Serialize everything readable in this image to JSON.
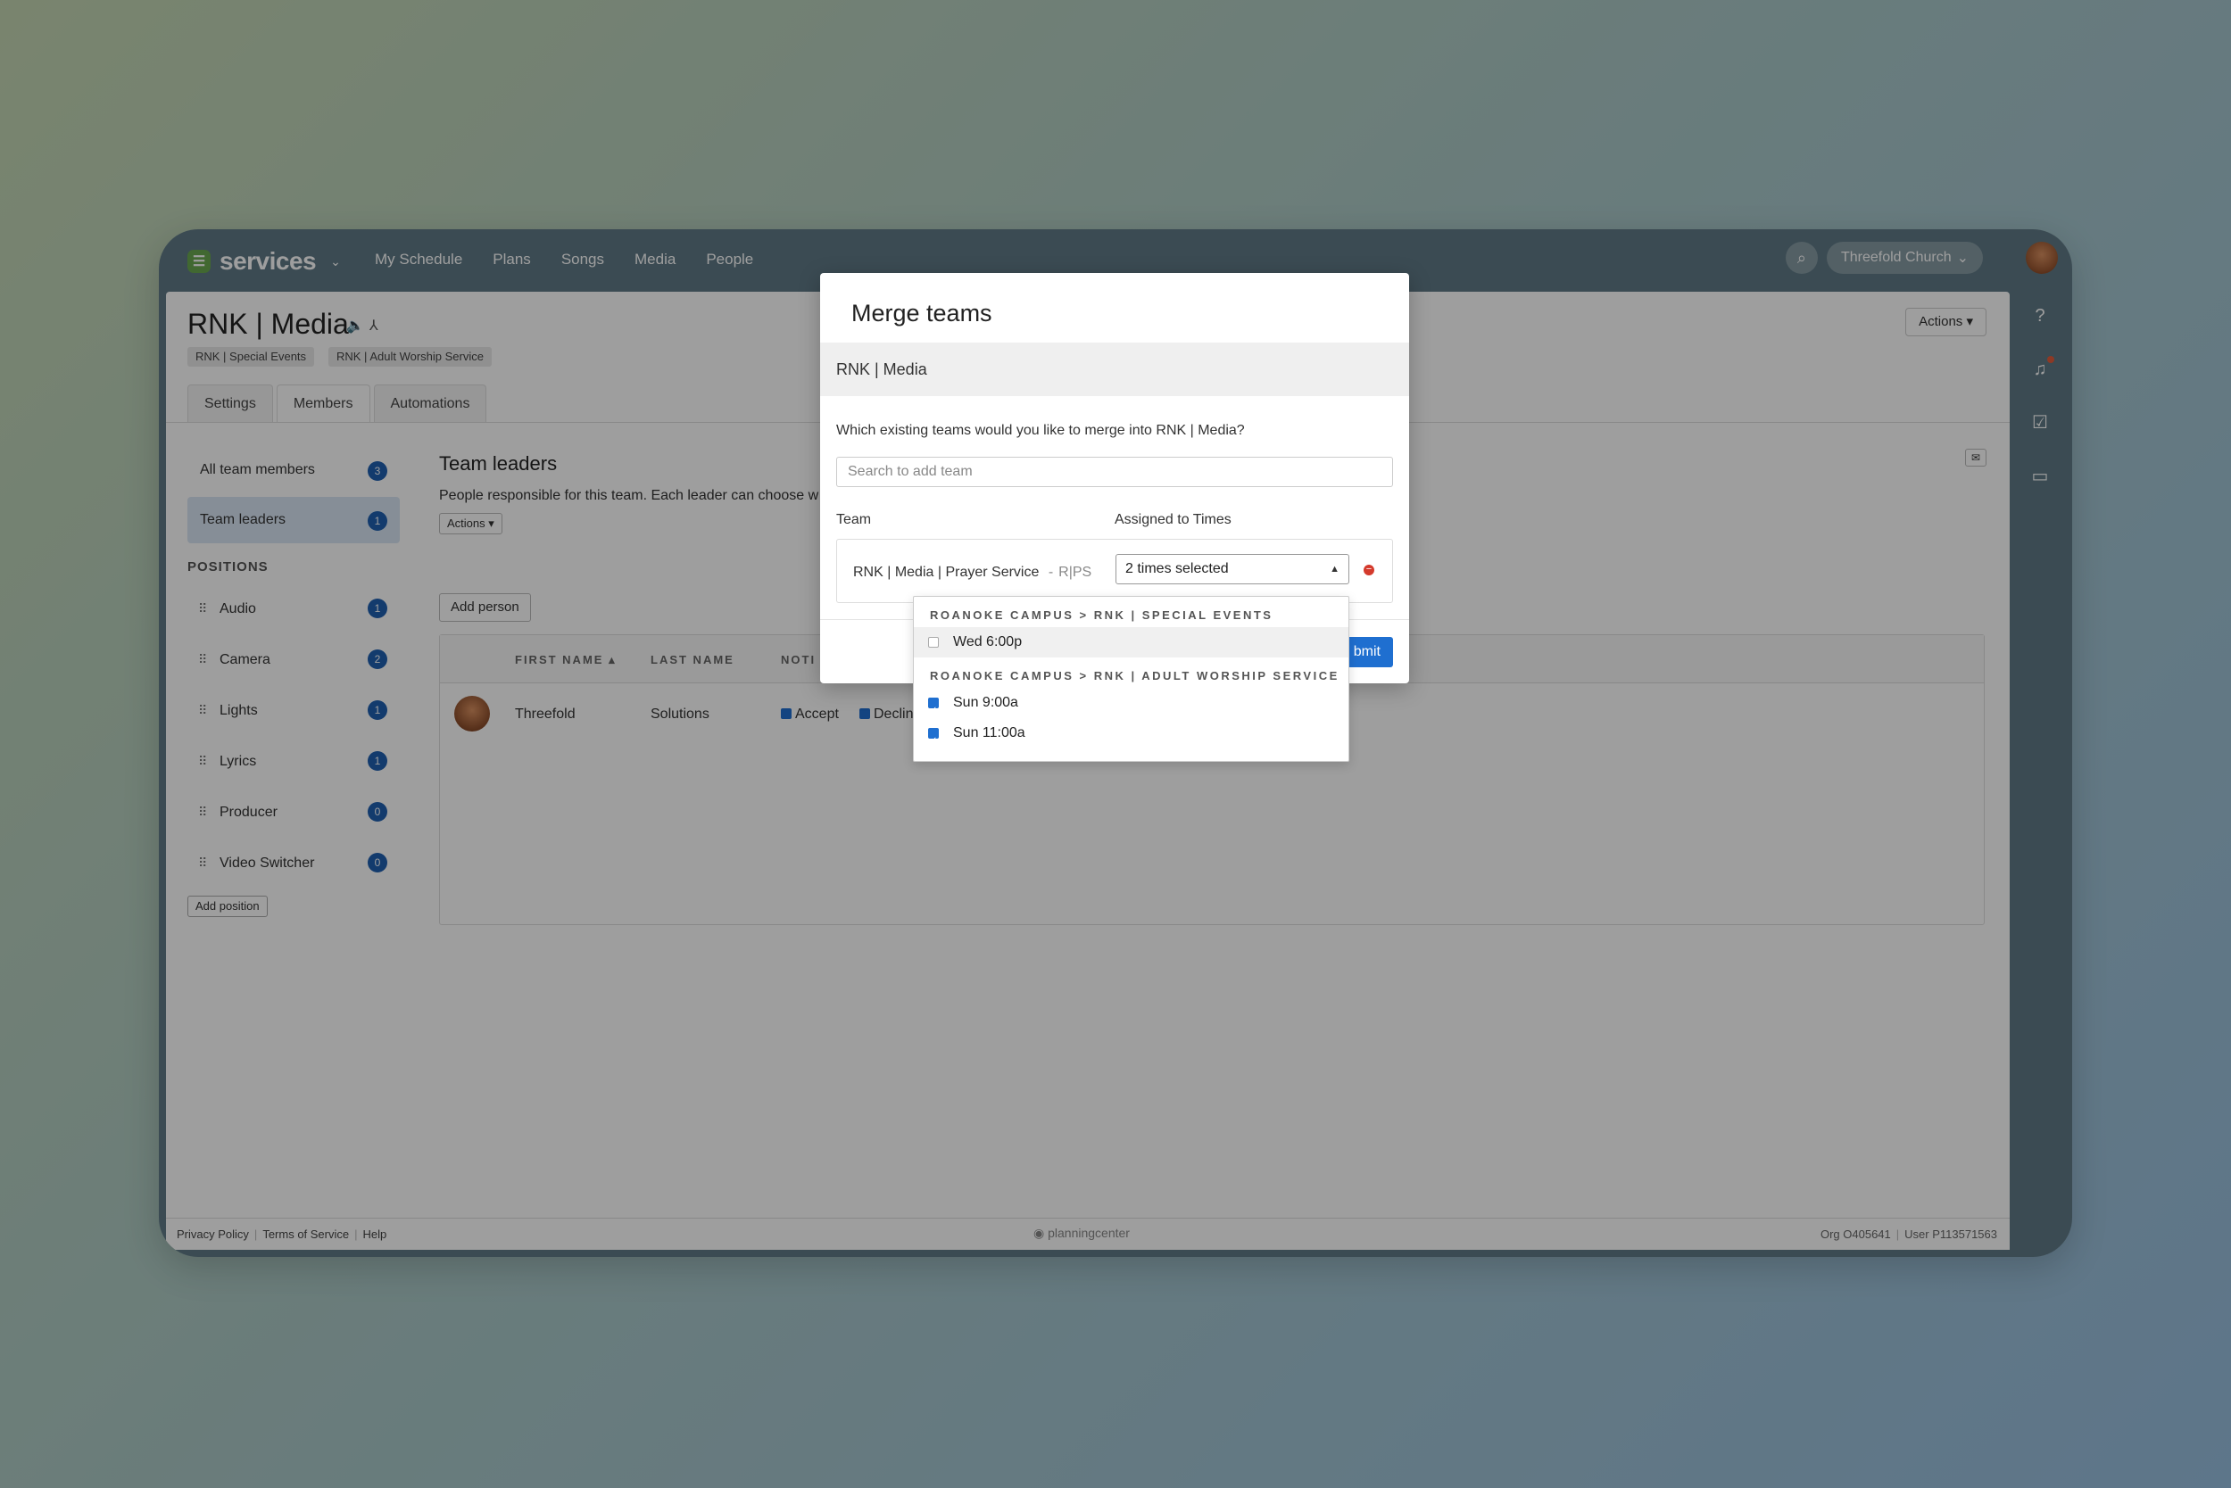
{
  "app": {
    "brand": "services",
    "nav": [
      "My Schedule",
      "Plans",
      "Songs",
      "Media",
      "People"
    ],
    "org": "Threefold Church"
  },
  "page": {
    "title": "RNK | Media",
    "tags": [
      "RNK | Special Events",
      "RNK | Adult Worship Service"
    ],
    "actions_label": "Actions",
    "tabs": [
      "Settings",
      "Members",
      "Automations"
    ]
  },
  "sidebar": {
    "items": [
      {
        "label": "All team members",
        "count": "3"
      },
      {
        "label": "Team leaders",
        "count": "1"
      }
    ],
    "positions_heading": "POSITIONS",
    "positions": [
      {
        "label": "Audio",
        "count": "1"
      },
      {
        "label": "Camera",
        "count": "2"
      },
      {
        "label": "Lights",
        "count": "1"
      },
      {
        "label": "Lyrics",
        "count": "1"
      },
      {
        "label": "Producer",
        "count": "0"
      },
      {
        "label": "Video Switcher",
        "count": "0"
      }
    ],
    "add_position": "Add position"
  },
  "main": {
    "heading": "Team leaders",
    "description": "People responsible for this team. Each leader can choose w",
    "actions_label": "Actions",
    "add_person": "Add person",
    "columns": [
      "FIRST NAME",
      "LAST NAME",
      "NOTI"
    ],
    "rows": [
      {
        "first": "Threefold",
        "last": "Solutions",
        "notify_1": "Accept",
        "notify_2": "Declin"
      }
    ]
  },
  "footer": {
    "links": [
      "Privacy Policy",
      "Terms of Service",
      "Help"
    ],
    "center": "planningcenter",
    "org_id": "Org O405641",
    "user_id": "User P113571563"
  },
  "modal": {
    "title": "Merge teams",
    "target_team": "RNK | Media",
    "question": "Which existing teams would you like to merge into RNK | Media?",
    "search_placeholder": "Search to add team",
    "col_team": "Team",
    "col_times": "Assigned to Times",
    "team_row": {
      "name": "RNK | Media | Prayer Service",
      "sep": "-",
      "abbr": "R|PS",
      "times_value": "2 times selected"
    },
    "submit_label": "Submit",
    "submit_visible": "bmit"
  },
  "dropdown": {
    "groups": [
      {
        "heading": "ROANOKE CAMPUS > RNK | SPECIAL EVENTS",
        "options": [
          {
            "label": "Wed 6:00p",
            "checked": false
          }
        ]
      },
      {
        "heading": "ROANOKE CAMPUS > RNK | ADULT WORSHIP SERVICE",
        "options": [
          {
            "label": "Sun 9:00a",
            "checked": true
          },
          {
            "label": "Sun 11:00a",
            "checked": true
          }
        ]
      }
    ]
  }
}
